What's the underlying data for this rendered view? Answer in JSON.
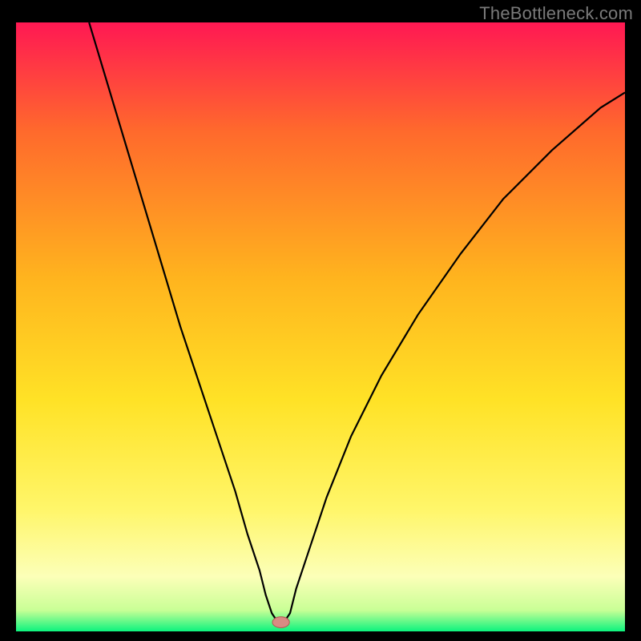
{
  "watermark": "TheBottleneck.com",
  "colors": {
    "black": "#000000",
    "curve": "#000000",
    "marker_fill": "#d98b83",
    "marker_stroke": "#b25a52",
    "grad_top": "#ff1853",
    "grad_upper": "#ff6a2c",
    "grad_mid_high": "#ffb41e",
    "grad_mid": "#ffe226",
    "grad_mid_low": "#fff66a",
    "grad_low": "#fcffb8",
    "grad_band": "#c9ff96",
    "grad_bottom": "#0cf37e"
  },
  "chart_data": {
    "type": "line",
    "title": "",
    "xlabel": "",
    "ylabel": "",
    "xlim": [
      0,
      100
    ],
    "ylim": [
      0,
      100
    ],
    "curve": {
      "x": [
        12,
        15,
        18,
        21,
        24,
        27,
        30,
        33,
        36,
        38,
        40,
        41,
        42,
        43,
        44,
        45,
        46,
        48,
        51,
        55,
        60,
        66,
        73,
        80,
        88,
        96,
        100
      ],
      "y": [
        100,
        90,
        80,
        70,
        60,
        50,
        41,
        32,
        23,
        16,
        10,
        6,
        3,
        1.5,
        1.5,
        3,
        7,
        13,
        22,
        32,
        42,
        52,
        62,
        71,
        79,
        86,
        88.5
      ]
    },
    "marker": {
      "x": 43.5,
      "y": 1.5,
      "rx": 1.4,
      "ry": 0.9
    }
  }
}
